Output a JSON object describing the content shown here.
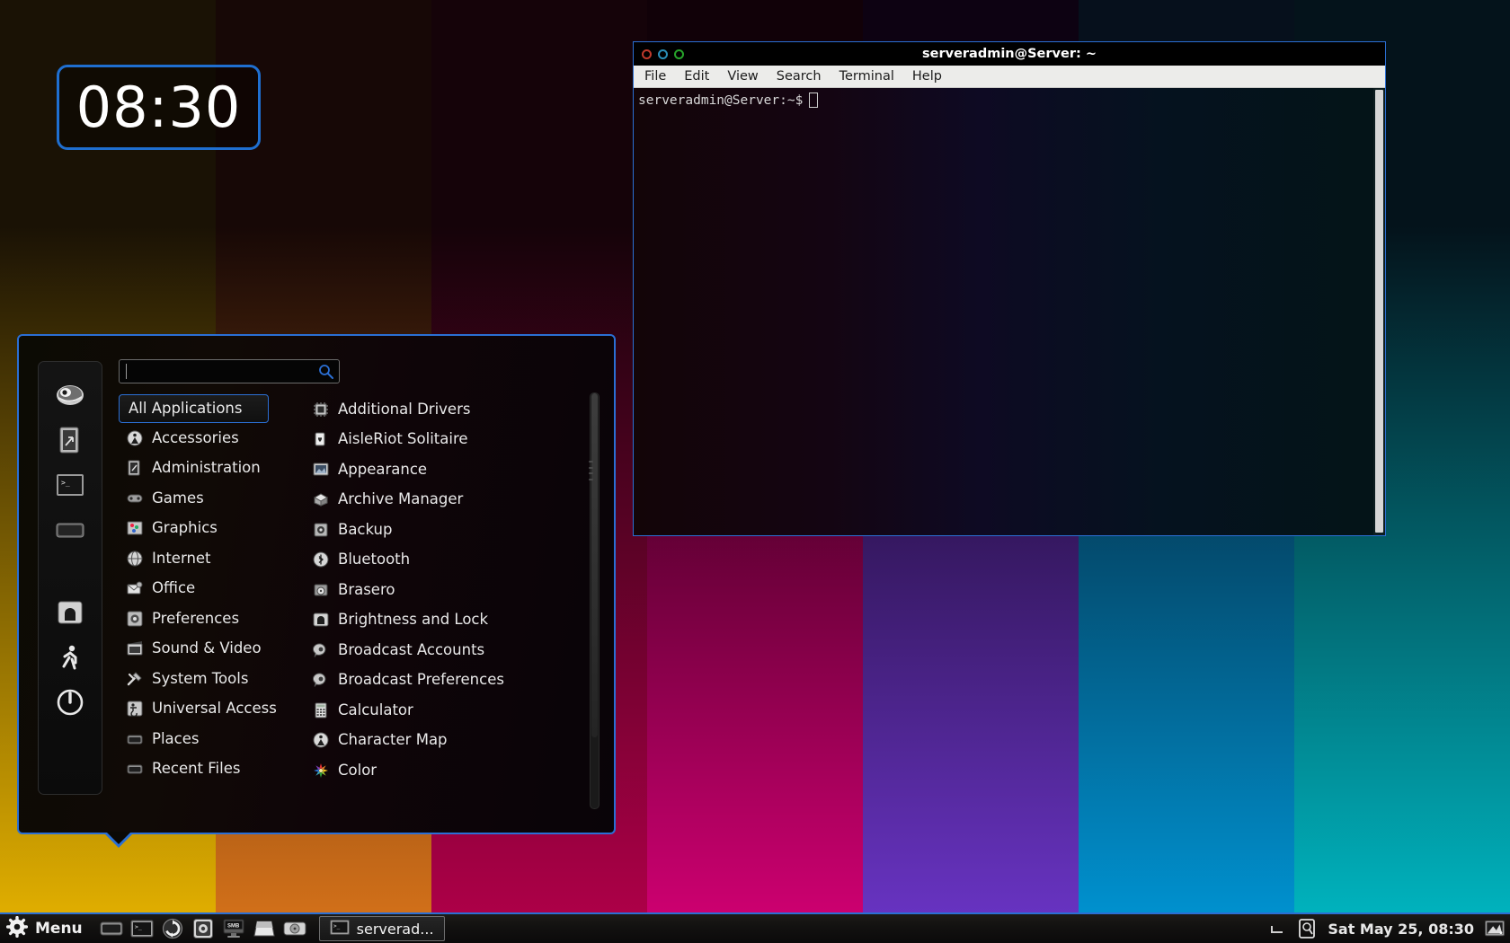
{
  "desktop": {
    "wallpaper_bands_top": [
      "#1a1205",
      "#170806",
      "#150309",
      "#110108",
      "#0d0212",
      "#06101c",
      "#04131b"
    ],
    "wallpaper_bands_bottom": [
      "#e8b400",
      "#d9741a",
      "#b3004a",
      "#d40074",
      "#6b35c8",
      "#0096d6",
      "#00b9c4"
    ],
    "accent": "#2b6fd4"
  },
  "clock_widget": {
    "time": "08:30",
    "border_color": "#1f6fd0"
  },
  "terminal": {
    "title": "serveradmin@Server: ~",
    "window_buttons": [
      "close-button",
      "minimize-button",
      "maximize-button"
    ],
    "menu": [
      "File",
      "Edit",
      "View",
      "Search",
      "Terminal",
      "Help"
    ],
    "prompt": "serveradmin@Server:~$",
    "cursor": "block-cursor"
  },
  "mint_menu": {
    "search": {
      "value": "",
      "placeholder": ""
    },
    "sidebar_icons": [
      "firefox-web-browser-icon",
      "software-manager-icon",
      "terminal-icon",
      "package-manager-icon",
      "lock-screen-icon",
      "logout-icon",
      "quit-power-icon"
    ],
    "selected_category": "All Applications",
    "categories": [
      {
        "label": "All Applications",
        "icon": "all-applications-icon",
        "selected": true
      },
      {
        "label": "Accessories",
        "icon": "accessories-icon"
      },
      {
        "label": "Administration",
        "icon": "administration-icon"
      },
      {
        "label": "Games",
        "icon": "games-gamepad-icon"
      },
      {
        "label": "Graphics",
        "icon": "graphics-icon"
      },
      {
        "label": "Internet",
        "icon": "internet-globe-icon"
      },
      {
        "label": "Office",
        "icon": "office-icon"
      },
      {
        "label": "Preferences",
        "icon": "preferences-gear-icon"
      },
      {
        "label": "Sound & Video",
        "icon": "sound-video-icon"
      },
      {
        "label": "System Tools",
        "icon": "system-tools-hammer-icon"
      },
      {
        "label": "Universal Access",
        "icon": "universal-access-icon"
      },
      {
        "label": "Places",
        "icon": "places-folder-icon"
      },
      {
        "label": "Recent Files",
        "icon": "recent-files-icon"
      }
    ],
    "applications": [
      {
        "label": "Additional Drivers",
        "icon": "additional-drivers-icon"
      },
      {
        "label": "AisleRiot Solitaire",
        "icon": "aisleriot-solitaire-cards-icon"
      },
      {
        "label": "Appearance",
        "icon": "appearance-icon"
      },
      {
        "label": "Archive Manager",
        "icon": "archive-manager-box-icon"
      },
      {
        "label": "Backup",
        "icon": "backup-icon"
      },
      {
        "label": "Bluetooth",
        "icon": "bluetooth-icon"
      },
      {
        "label": "Brasero",
        "icon": "brasero-disc-burner-icon"
      },
      {
        "label": "Brightness and Lock",
        "icon": "brightness-lock-icon"
      },
      {
        "label": "Broadcast Accounts",
        "icon": "broadcast-accounts-icon"
      },
      {
        "label": "Broadcast Preferences",
        "icon": "broadcast-preferences-icon"
      },
      {
        "label": "Calculator",
        "icon": "calculator-icon"
      },
      {
        "label": "Character Map",
        "icon": "character-map-icon"
      },
      {
        "label": "Color",
        "icon": "color-icon"
      }
    ]
  },
  "taskbar": {
    "menu_label": "Menu",
    "menu_icon": "mint-gear-icon",
    "quick_launch": [
      "show-desktop-icon",
      "terminal-icon",
      "update-manager-icon",
      "software-manager-icon",
      "samba-share-icon",
      "disk-icon",
      "hard-drive-icon"
    ],
    "windows": [
      {
        "label": "serverad...",
        "icon": "terminal-icon",
        "active": true
      }
    ],
    "tray": {
      "icons": [
        "keyboard-tray-icon",
        "removable-media-tray-icon",
        "display-tray-icon"
      ],
      "clock": "Sat May 25, 08:30"
    }
  }
}
